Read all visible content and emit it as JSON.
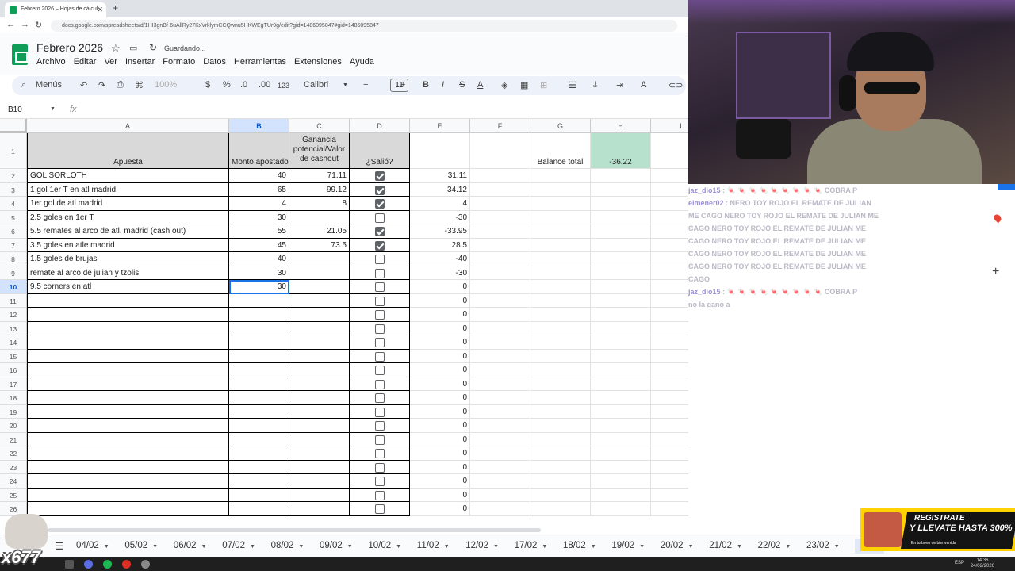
{
  "browser": {
    "tab_title": "Febrero 2026 – Hojas de cálcul",
    "url": "docs.google.com/spreadsheets/d/1HI3gnBf-6uAllRy27KxVrklymCCQwnu5HKWEgTUr9g/edit?gid=1486095847#gid=1486095847"
  },
  "doc": {
    "title": "Febrero 2026",
    "status": "Guardando...",
    "menu": [
      "Archivo",
      "Editar",
      "Ver",
      "Insertar",
      "Formato",
      "Datos",
      "Herramientas",
      "Extensiones",
      "Ayuda"
    ]
  },
  "toolbar": {
    "search_label": "Menús",
    "zoom": "100%",
    "currency": "$",
    "percent": "%",
    "decimal_dec": ".0",
    "decimal_inc": ".00",
    "number_format": "123",
    "font": "Calibri",
    "font_size": "11"
  },
  "formula_bar": {
    "name_box": "B10",
    "fx": "fx"
  },
  "columns": [
    "A",
    "B",
    "C",
    "D",
    "E",
    "F",
    "G",
    "H",
    "I"
  ],
  "header_row": {
    "row_num": "1",
    "a": "Apuesta",
    "b": "Monto apostado",
    "c": "Ganancia potencial/Valor de cashout",
    "d": "¿Salió?",
    "g": "Balance total",
    "h": "-36.22"
  },
  "rows": [
    {
      "n": "2",
      "a": "GOL SORLOTH",
      "b": "40",
      "c": "71.11",
      "d": true,
      "e": "31.11"
    },
    {
      "n": "3",
      "a": "1 gol 1er T en atl madrid",
      "b": "65",
      "c": "99.12",
      "d": true,
      "e": "34.12"
    },
    {
      "n": "4",
      "a": "1er gol de atl madrid",
      "b": "4",
      "c": "8",
      "d": true,
      "e": "4"
    },
    {
      "n": "5",
      "a": "2.5 goles en 1er T",
      "b": "30",
      "c": "",
      "d": false,
      "e": "-30"
    },
    {
      "n": "6",
      "a": "5.5 remates al arco de atl. madrid (cash out)",
      "b": "55",
      "c": "21.05",
      "d": true,
      "e": "-33.95"
    },
    {
      "n": "7",
      "a": "3.5 goles en atle madrid",
      "b": "45",
      "c": "73.5",
      "d": true,
      "e": "28.5"
    },
    {
      "n": "8",
      "a": "1.5 goles de brujas",
      "b": "40",
      "c": "",
      "d": false,
      "e": "-40"
    },
    {
      "n": "9",
      "a": "remate al arco de julian y tzolis",
      "b": "30",
      "c": "",
      "d": false,
      "e": "-30"
    },
    {
      "n": "10",
      "a": "9.5 corners en atl",
      "b": "30",
      "c": "",
      "d": false,
      "e": "0"
    },
    {
      "n": "11",
      "a": "",
      "b": "",
      "c": "",
      "d": false,
      "e": "0"
    },
    {
      "n": "12",
      "a": "",
      "b": "",
      "c": "",
      "d": false,
      "e": "0"
    },
    {
      "n": "13",
      "a": "",
      "b": "",
      "c": "",
      "d": false,
      "e": "0"
    },
    {
      "n": "14",
      "a": "",
      "b": "",
      "c": "",
      "d": false,
      "e": "0"
    },
    {
      "n": "15",
      "a": "",
      "b": "",
      "c": "",
      "d": false,
      "e": "0"
    },
    {
      "n": "16",
      "a": "",
      "b": "",
      "c": "",
      "d": false,
      "e": "0"
    },
    {
      "n": "17",
      "a": "",
      "b": "",
      "c": "",
      "d": false,
      "e": "0"
    },
    {
      "n": "18",
      "a": "",
      "b": "",
      "c": "",
      "d": false,
      "e": "0"
    },
    {
      "n": "19",
      "a": "",
      "b": "",
      "c": "",
      "d": false,
      "e": "0"
    },
    {
      "n": "20",
      "a": "",
      "b": "",
      "c": "",
      "d": false,
      "e": "0"
    },
    {
      "n": "21",
      "a": "",
      "b": "",
      "c": "",
      "d": false,
      "e": "0"
    },
    {
      "n": "22",
      "a": "",
      "b": "",
      "c": "",
      "d": false,
      "e": "0"
    },
    {
      "n": "23",
      "a": "",
      "b": "",
      "c": "",
      "d": false,
      "e": "0"
    },
    {
      "n": "24",
      "a": "",
      "b": "",
      "c": "",
      "d": false,
      "e": "0"
    },
    {
      "n": "25",
      "a": "",
      "b": "",
      "c": "",
      "d": false,
      "e": "0"
    },
    {
      "n": "26",
      "a": "",
      "b": "",
      "c": "",
      "d": false,
      "e": "0"
    }
  ],
  "selected_row": "10",
  "sheet_tabs": [
    "04/02",
    "05/02",
    "06/02",
    "07/02",
    "08/02",
    "09/02",
    "10/02",
    "11/02",
    "12/02",
    "17/02",
    "18/02",
    "19/02",
    "20/02",
    "21/02",
    "22/02",
    "23/02",
    "24"
  ],
  "chat": [
    {
      "user": "jaz_dio15",
      "msg": ": 🍬 🍬 🍬 🍬 🍬 🍬 🍬 🍬 🍬 COBRA P"
    },
    {
      "user": "elmener02",
      "msg": ": NERO TOY ROJO EL REMATE DE JULIAN"
    },
    {
      "user": "",
      "msg": "ME CAGO NERO TOY ROJO EL REMATE DE JULIAN ME"
    },
    {
      "user": "",
      "msg": "CAGO NERO TOY ROJO EL REMATE DE JULIAN ME"
    },
    {
      "user": "",
      "msg": "CAGO NERO TOY ROJO EL REMATE DE JULIAN ME"
    },
    {
      "user": "",
      "msg": "CAGO NERO TOY ROJO EL REMATE DE JULIAN ME"
    },
    {
      "user": "",
      "msg": "CAGO NERO TOY ROJO EL REMATE DE JULIAN ME"
    },
    {
      "user": "",
      "msg": "CAGO"
    },
    {
      "user": "jaz_dio15",
      "msg": ": 🍬 🍬 🍬 🍬 🍬 🍬 🍬 🍬 🍬 COBRA P"
    },
    {
      "user": "",
      "msg": "no la ganó a"
    }
  ],
  "promo": {
    "line1": "REGISTRATE",
    "line2": "Y LLEVATE HASTA 300%",
    "line3": "En tu bono de bienvenida"
  },
  "overlay_badge": "x677",
  "taskbar": {
    "lang": "ESP",
    "time": "14:36",
    "date": "24/02/2026"
  },
  "colors": {
    "balance_green": "#b7e1cd",
    "header_grey": "#d9d9d9",
    "selection_blue": "#1a73e8",
    "promo_yellow": "#ffd200"
  }
}
